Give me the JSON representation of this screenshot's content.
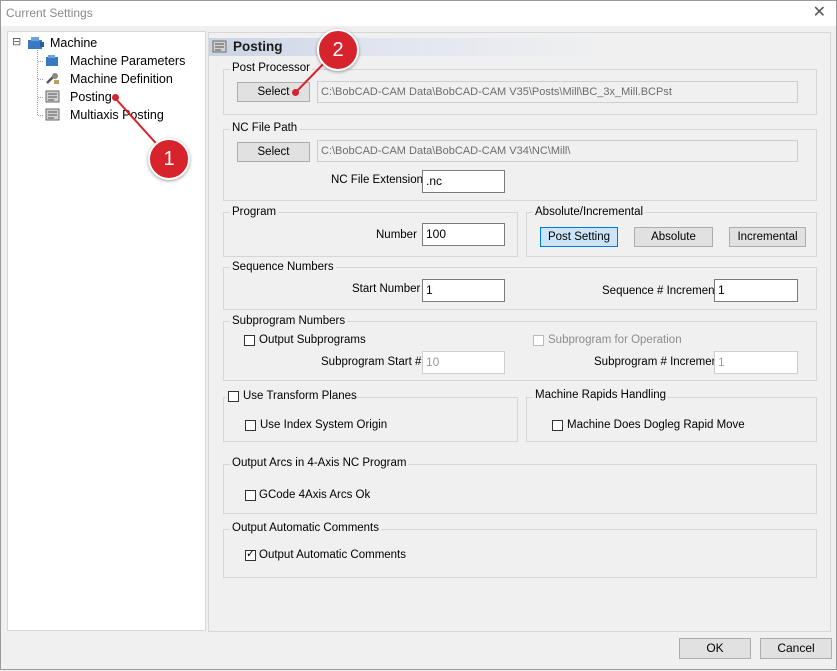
{
  "window": {
    "title": "Current Settings",
    "close_glyph": "✕"
  },
  "tree": {
    "root_expander": "⊟",
    "root": "Machine",
    "items": [
      "Machine Parameters",
      "Machine Definition",
      "Posting",
      "Multiaxis Posting"
    ]
  },
  "header": {
    "title": "Posting"
  },
  "post_processor": {
    "label": "Post Processor",
    "select_label": "Select",
    "path": "C:\\BobCAD-CAM Data\\BobCAD-CAM V35\\Posts\\Mill\\BC_3x_Mill.BCPst"
  },
  "nc_file_path": {
    "label": "NC File Path",
    "select_label": "Select",
    "path": "C:\\BobCAD-CAM Data\\BobCAD-CAM V34\\NC\\Mill\\",
    "ext_label": "NC File Extension",
    "ext_value": ".nc"
  },
  "program": {
    "label": "Program",
    "number_label": "Number",
    "number_value": "100"
  },
  "abs_inc": {
    "label": "Absolute/Incremental",
    "buttons": [
      "Post Setting",
      "Absolute",
      "Incremental"
    ]
  },
  "sequence": {
    "label": "Sequence Numbers",
    "start_label": "Start Number",
    "start_value": "1",
    "increment_label": "Sequence # Increment",
    "increment_value": "1"
  },
  "subprogram": {
    "label": "Subprogram Numbers",
    "output_label": "Output Subprograms",
    "for_operation_label": "Subprogram for Operation",
    "start_label": "Subprogram Start #",
    "start_value": "10",
    "increment_label": "Subprogram # Increment",
    "increment_value": "1"
  },
  "transform": {
    "use_label": "Use Transform Planes",
    "index_label": "Use Index System Origin"
  },
  "rapids": {
    "label": "Machine Rapids Handling",
    "dogleg_label": "Machine Does Dogleg Rapid Move"
  },
  "arcs": {
    "label": "Output Arcs in 4-Axis NC Program",
    "gcode_label": "GCode 4Axis Arcs Ok"
  },
  "comments": {
    "label": "Output Automatic Comments",
    "check_label": "Output Automatic Comments",
    "checked_glyph": "✓"
  },
  "footer": {
    "ok": "OK",
    "cancel": "Cancel"
  },
  "callouts": [
    "1",
    "2"
  ],
  "colors": {
    "callout": "#d7242c",
    "selected_button": "#cce4f7",
    "header_gradient": "#c9d3e3"
  }
}
